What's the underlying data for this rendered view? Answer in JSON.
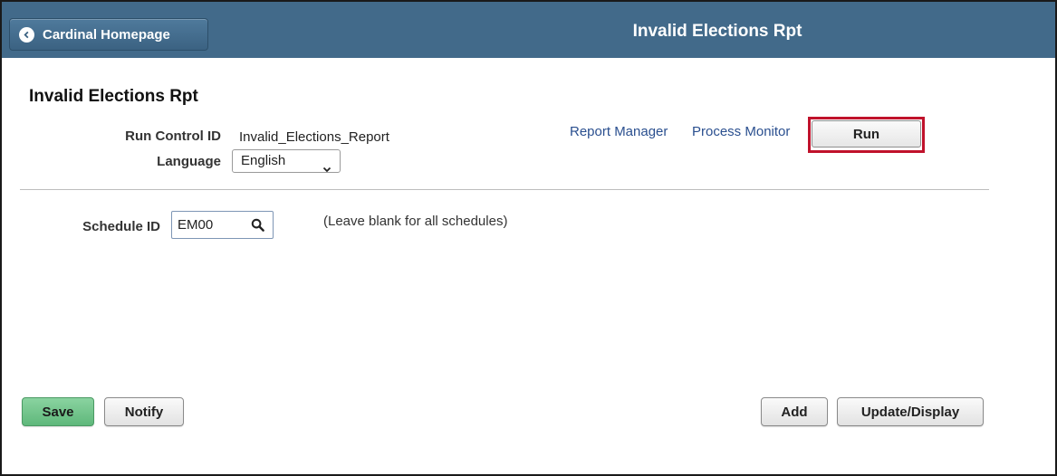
{
  "header": {
    "home_button_label": "Cardinal Homepage",
    "title": "Invalid Elections Rpt"
  },
  "page": {
    "heading": "Invalid Elections Rpt"
  },
  "run_control": {
    "label": "Run Control ID",
    "value": "Invalid_Elections_Report"
  },
  "language": {
    "label": "Language",
    "selected": "English"
  },
  "links": {
    "report_manager": "Report Manager",
    "process_monitor": "Process Monitor"
  },
  "run_button_label": "Run",
  "schedule": {
    "label": "Schedule ID",
    "value": "EM00",
    "hint": "(Leave blank for all schedules)"
  },
  "footer": {
    "save_label": "Save",
    "notify_label": "Notify",
    "add_label": "Add",
    "update_display_label": "Update/Display"
  },
  "colors": {
    "header_bg": "#426a8a",
    "highlight": "#c0122b",
    "save_green": "#6cc487",
    "link": "#2a4f8f"
  },
  "icons": {
    "home_chevron": "chevron-left-icon",
    "search": "search-icon",
    "dropdown": "chevron-down-icon"
  }
}
